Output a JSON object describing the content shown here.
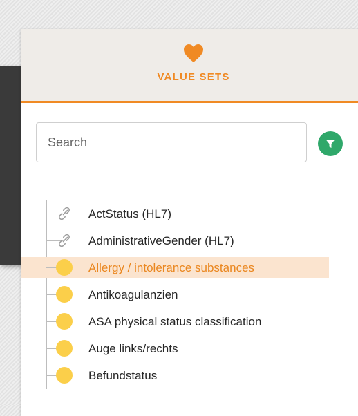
{
  "colors": {
    "accent": "#f08a24",
    "filter_button": "#2fa86a",
    "selection_bg": "#fbe4cf",
    "dot": "#fbcf4a"
  },
  "header": {
    "icon": "heart-icon",
    "title": "VALUE SETS"
  },
  "search": {
    "placeholder": "Search",
    "value": "",
    "filter_icon": "filter-icon"
  },
  "tree": {
    "selected_index": 2,
    "items": [
      {
        "label": "ActStatus (HL7)",
        "icon": "link-icon"
      },
      {
        "label": "AdministrativeGender (HL7)",
        "icon": "link-icon"
      },
      {
        "label": "Allergy / intolerance substances",
        "icon": "dot-icon"
      },
      {
        "label": "Antikoagulanzien",
        "icon": "dot-icon"
      },
      {
        "label": "ASA physical status classification",
        "icon": "dot-icon"
      },
      {
        "label": "Auge links/rechts",
        "icon": "dot-icon"
      },
      {
        "label": "Befundstatus",
        "icon": "dot-icon"
      }
    ]
  }
}
